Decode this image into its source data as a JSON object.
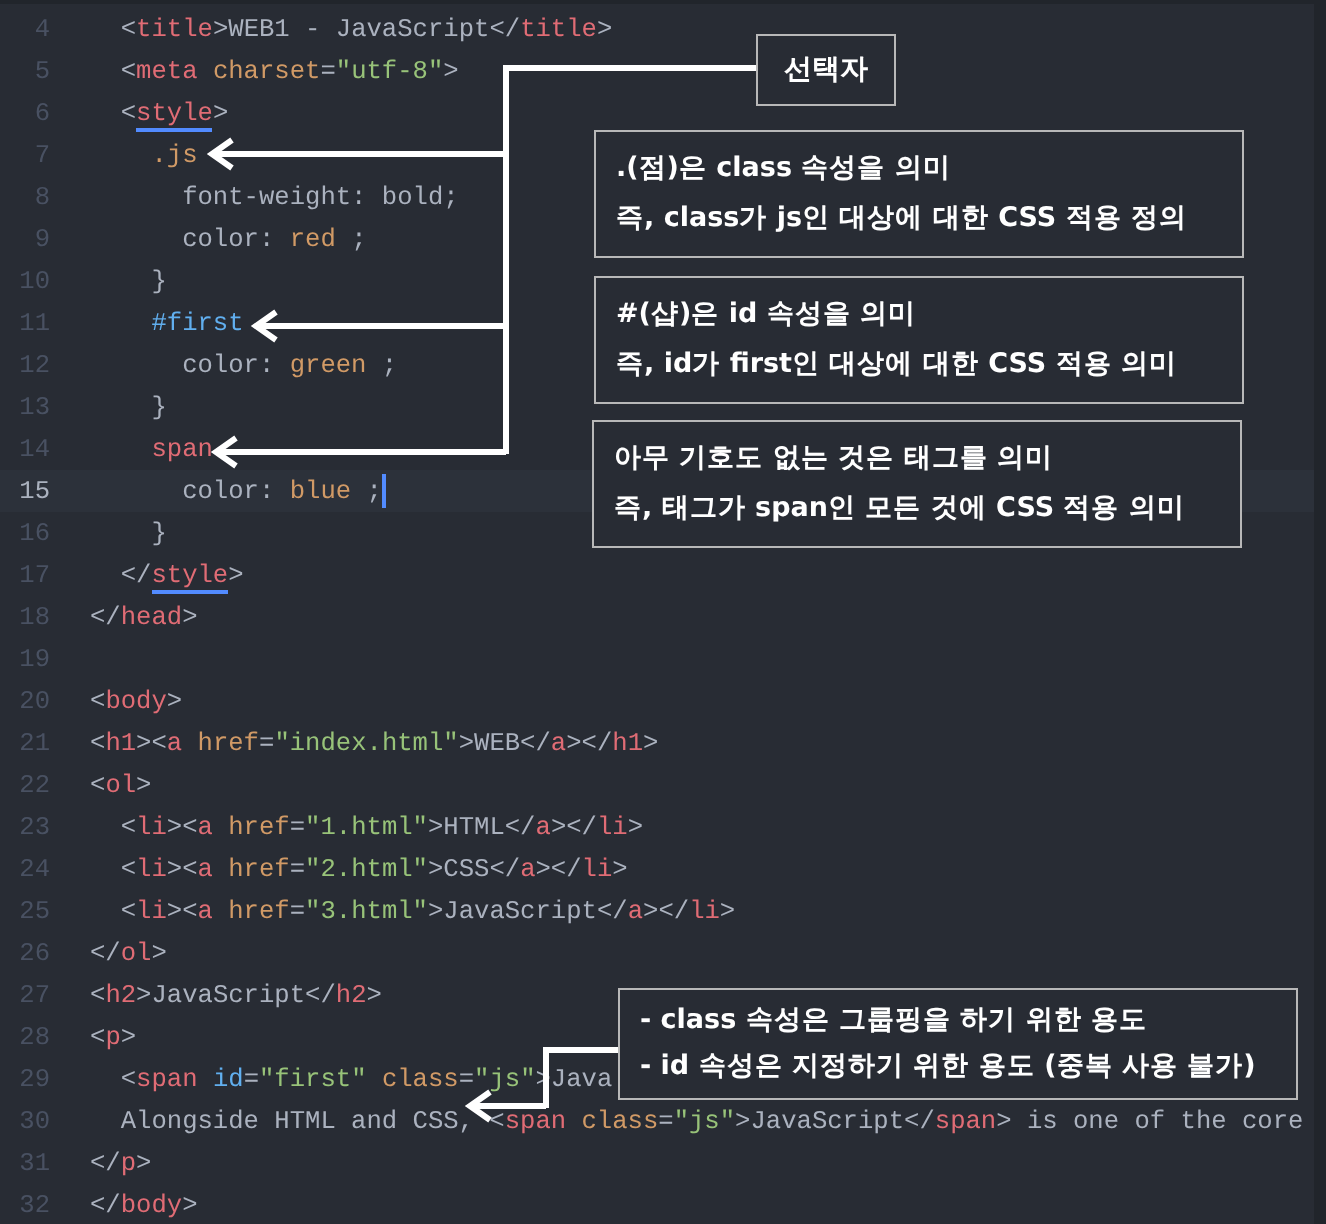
{
  "editor": {
    "lines": [
      {
        "number": "4",
        "current": false,
        "tokens": [
          {
            "kind": "p",
            "text": "  <"
          },
          {
            "kind": "tag",
            "text": "title"
          },
          {
            "kind": "p",
            "text": ">"
          },
          {
            "kind": "txt",
            "text": "WEB1 - JavaScript"
          },
          {
            "kind": "p",
            "text": "</"
          },
          {
            "kind": "tag",
            "text": "title"
          },
          {
            "kind": "p",
            "text": ">"
          }
        ]
      },
      {
        "number": "5",
        "current": false,
        "tokens": [
          {
            "kind": "p",
            "text": "  <"
          },
          {
            "kind": "tag",
            "text": "meta"
          },
          {
            "kind": "attr",
            "text": " charset"
          },
          {
            "kind": "p",
            "text": "="
          },
          {
            "kind": "str",
            "text": "\"utf-8\""
          },
          {
            "kind": "p",
            "text": ">"
          }
        ]
      },
      {
        "number": "6",
        "current": false,
        "tokens": [
          {
            "kind": "p",
            "text": "  <"
          },
          {
            "kind": "tagm",
            "text": "style"
          },
          {
            "kind": "p",
            "text": ">"
          }
        ]
      },
      {
        "number": "7",
        "current": false,
        "tokens": [
          {
            "kind": "sel",
            "text": "    .js"
          }
        ]
      },
      {
        "number": "8",
        "current": false,
        "tokens": [
          {
            "kind": "p",
            "text": "      font-weight: bold;"
          }
        ]
      },
      {
        "number": "9",
        "current": false,
        "tokens": [
          {
            "kind": "p",
            "text": "      color: "
          },
          {
            "kind": "val",
            "text": "red"
          },
          {
            "kind": "p",
            "text": " ;"
          }
        ]
      },
      {
        "number": "10",
        "current": false,
        "tokens": [
          {
            "kind": "p",
            "text": "    }"
          }
        ]
      },
      {
        "number": "11",
        "current": false,
        "tokens": [
          {
            "kind": "id",
            "text": "    #first"
          }
        ]
      },
      {
        "number": "12",
        "current": false,
        "tokens": [
          {
            "kind": "p",
            "text": "      color: "
          },
          {
            "kind": "val",
            "text": "green"
          },
          {
            "kind": "p",
            "text": " ;"
          }
        ]
      },
      {
        "number": "13",
        "current": false,
        "tokens": [
          {
            "kind": "p",
            "text": "    }"
          }
        ]
      },
      {
        "number": "14",
        "current": false,
        "tokens": [
          {
            "kind": "tag",
            "text": "    span"
          }
        ]
      },
      {
        "number": "15",
        "current": true,
        "tokens": [
          {
            "kind": "p",
            "text": "      color: "
          },
          {
            "kind": "val",
            "text": "blue"
          },
          {
            "kind": "p",
            "text": " ;"
          }
        ]
      },
      {
        "number": "16",
        "current": false,
        "tokens": [
          {
            "kind": "p",
            "text": "    }"
          }
        ]
      },
      {
        "number": "17",
        "current": false,
        "tokens": [
          {
            "kind": "p",
            "text": "  </"
          },
          {
            "kind": "tagm",
            "text": "style"
          },
          {
            "kind": "p",
            "text": ">"
          }
        ]
      },
      {
        "number": "18",
        "current": false,
        "tokens": [
          {
            "kind": "p",
            "text": "</"
          },
          {
            "kind": "tag",
            "text": "head"
          },
          {
            "kind": "p",
            "text": ">"
          }
        ]
      },
      {
        "number": "19",
        "current": false
      },
      {
        "number": "20",
        "current": false,
        "tokens": [
          {
            "kind": "p",
            "text": "<"
          },
          {
            "kind": "tag",
            "text": "body"
          },
          {
            "kind": "p",
            "text": ">"
          }
        ]
      },
      {
        "number": "21",
        "current": false,
        "tokens": [
          {
            "kind": "p",
            "text": "<"
          },
          {
            "kind": "tag",
            "text": "h1"
          },
          {
            "kind": "p",
            "text": "><"
          },
          {
            "kind": "tag",
            "text": "a"
          },
          {
            "kind": "attr",
            "text": " href"
          },
          {
            "kind": "p",
            "text": "="
          },
          {
            "kind": "str",
            "text": "\"index.html\""
          },
          {
            "kind": "p",
            "text": ">WEB</"
          },
          {
            "kind": "tag",
            "text": "a"
          },
          {
            "kind": "p",
            "text": "></"
          },
          {
            "kind": "tag",
            "text": "h1"
          },
          {
            "kind": "p",
            "text": ">"
          }
        ]
      },
      {
        "number": "22",
        "current": false,
        "tokens": [
          {
            "kind": "p",
            "text": "<"
          },
          {
            "kind": "tag",
            "text": "ol"
          },
          {
            "kind": "p",
            "text": ">"
          }
        ]
      },
      {
        "number": "23",
        "current": false,
        "tokens": [
          {
            "kind": "p",
            "text": "  <"
          },
          {
            "kind": "tag",
            "text": "li"
          },
          {
            "kind": "p",
            "text": "><"
          },
          {
            "kind": "tag",
            "text": "a"
          },
          {
            "kind": "attr",
            "text": " href"
          },
          {
            "kind": "p",
            "text": "="
          },
          {
            "kind": "str",
            "text": "\"1.html\""
          },
          {
            "kind": "p",
            "text": ">HTML</"
          },
          {
            "kind": "tag",
            "text": "a"
          },
          {
            "kind": "p",
            "text": "></"
          },
          {
            "kind": "tag",
            "text": "li"
          },
          {
            "kind": "p",
            "text": ">"
          }
        ]
      },
      {
        "number": "24",
        "current": false,
        "tokens": [
          {
            "kind": "p",
            "text": "  <"
          },
          {
            "kind": "tag",
            "text": "li"
          },
          {
            "kind": "p",
            "text": "><"
          },
          {
            "kind": "tag",
            "text": "a"
          },
          {
            "kind": "attr",
            "text": " href"
          },
          {
            "kind": "p",
            "text": "="
          },
          {
            "kind": "str",
            "text": "\"2.html\""
          },
          {
            "kind": "p",
            "text": ">CSS</"
          },
          {
            "kind": "tag",
            "text": "a"
          },
          {
            "kind": "p",
            "text": "></"
          },
          {
            "kind": "tag",
            "text": "li"
          },
          {
            "kind": "p",
            "text": ">"
          }
        ]
      },
      {
        "number": "25",
        "current": false,
        "tokens": [
          {
            "kind": "p",
            "text": "  <"
          },
          {
            "kind": "tag",
            "text": "li"
          },
          {
            "kind": "p",
            "text": "><"
          },
          {
            "kind": "tag",
            "text": "a"
          },
          {
            "kind": "attr",
            "text": " href"
          },
          {
            "kind": "p",
            "text": "="
          },
          {
            "kind": "str",
            "text": "\"3.html\""
          },
          {
            "kind": "p",
            "text": ">JavaScript</"
          },
          {
            "kind": "tag",
            "text": "a"
          },
          {
            "kind": "p",
            "text": "></"
          },
          {
            "kind": "tag",
            "text": "li"
          },
          {
            "kind": "p",
            "text": ">"
          }
        ]
      },
      {
        "number": "26",
        "current": false,
        "tokens": [
          {
            "kind": "p",
            "text": "</"
          },
          {
            "kind": "tag",
            "text": "ol"
          },
          {
            "kind": "p",
            "text": ">"
          }
        ]
      },
      {
        "number": "27",
        "current": false,
        "tokens": [
          {
            "kind": "p",
            "text": "<"
          },
          {
            "kind": "tag",
            "text": "h2"
          },
          {
            "kind": "p",
            "text": ">JavaScript</"
          },
          {
            "kind": "tag",
            "text": "h2"
          },
          {
            "kind": "p",
            "text": ">"
          }
        ]
      },
      {
        "number": "28",
        "current": false,
        "tokens": [
          {
            "kind": "p",
            "text": "<"
          },
          {
            "kind": "tag",
            "text": "p"
          },
          {
            "kind": "p",
            "text": ">"
          }
        ]
      },
      {
        "number": "29",
        "current": false,
        "tokens": [
          {
            "kind": "p",
            "text": "  <"
          },
          {
            "kind": "tag",
            "text": "span"
          },
          {
            "kind": "id",
            "text": " id"
          },
          {
            "kind": "p",
            "text": "="
          },
          {
            "kind": "str",
            "text": "\"first\""
          },
          {
            "kind": "attr",
            "text": " class"
          },
          {
            "kind": "p",
            "text": "="
          },
          {
            "kind": "str",
            "text": "\"js\""
          },
          {
            "kind": "p",
            "text": ">Java"
          }
        ]
      },
      {
        "number": "30",
        "current": false,
        "tokens": [
          {
            "kind": "p",
            "text": "  Alongside HTML and CSS, <"
          },
          {
            "kind": "tag",
            "text": "span"
          },
          {
            "kind": "attr",
            "text": " class"
          },
          {
            "kind": "p",
            "text": "="
          },
          {
            "kind": "str",
            "text": "\"js\""
          },
          {
            "kind": "p",
            "text": ">JavaScript</"
          },
          {
            "kind": "tag",
            "text": "span"
          },
          {
            "kind": "p",
            "text": "> is one of the core"
          }
        ]
      },
      {
        "number": "31",
        "current": false,
        "tokens": [
          {
            "kind": "p",
            "text": "</"
          },
          {
            "kind": "tag",
            "text": "p"
          },
          {
            "kind": "p",
            "text": ">"
          }
        ]
      },
      {
        "number": "32",
        "current": false,
        "tokens": [
          {
            "kind": "p",
            "text": "</"
          },
          {
            "kind": "tag",
            "text": "body"
          },
          {
            "kind": "p",
            "text": ">"
          }
        ]
      }
    ]
  },
  "annotations": {
    "label": "선택자",
    "notes": [
      {
        "lines": [
          ".(점)은 class 속성을 의미",
          "즉, class가 js인 대상에 대한 CSS 적용 정의"
        ]
      },
      {
        "lines": [
          "#(샵)은 id 속성을 의미",
          "즉, id가 first인 대상에 대한 CSS 적용 의미"
        ]
      },
      {
        "lines": [
          "아무 기호도 없는 것은 태그를 의미",
          "즉, 태그가 span인 모든 것에 CSS 적용 의미"
        ]
      },
      {
        "lines": [
          "- class 속성은 그룹핑을 하기 위한 용도",
          "- id 속성은 지정하기 위한 용도 (중복 사용 불가)"
        ]
      }
    ]
  }
}
